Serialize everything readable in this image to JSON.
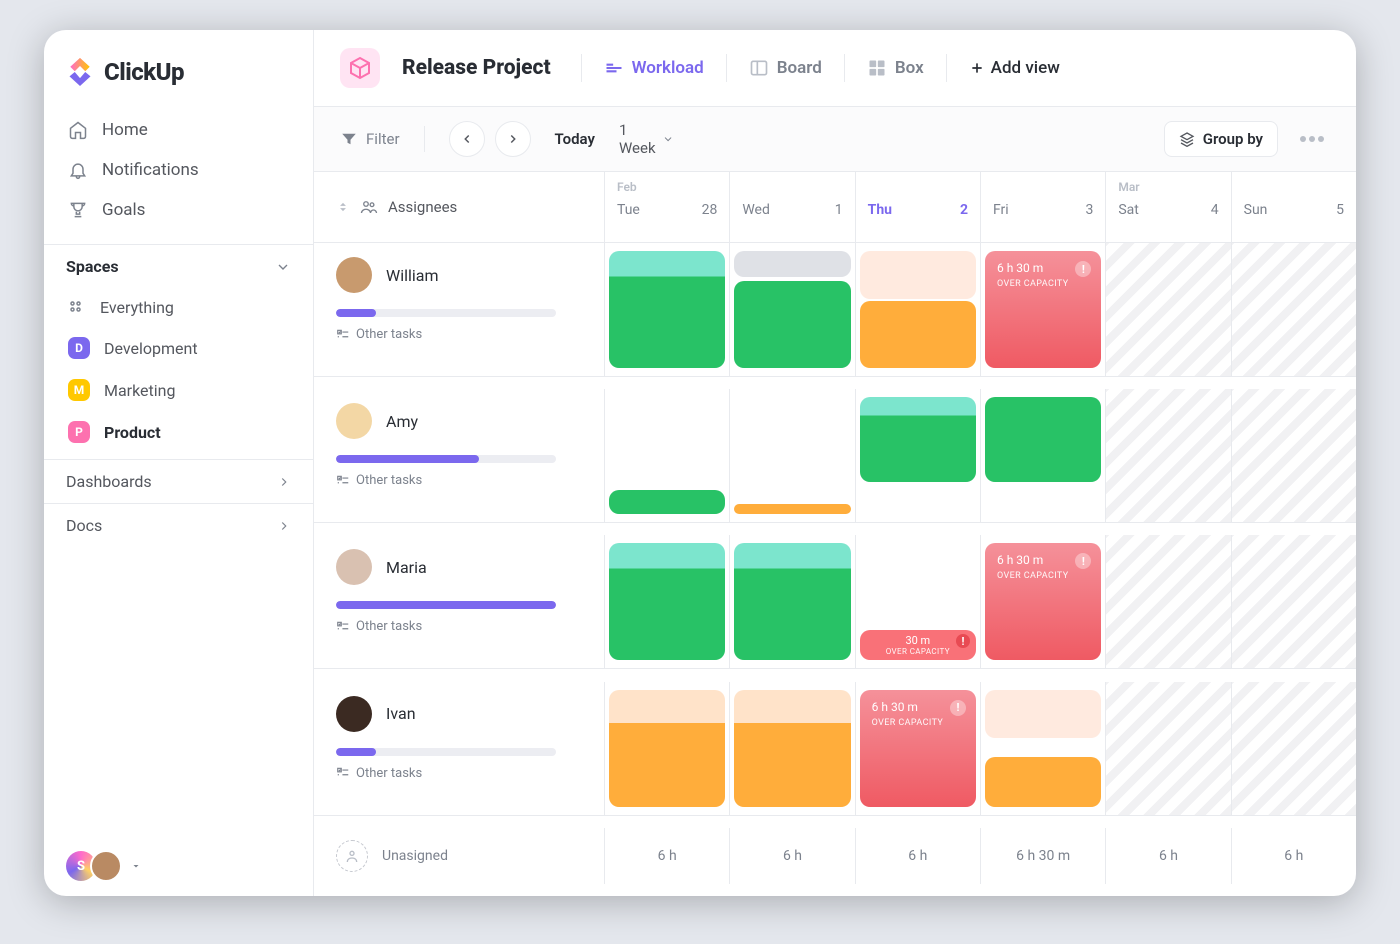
{
  "brand": {
    "name": "ClickUp"
  },
  "nav": {
    "home": "Home",
    "notifications": "Notifications",
    "goals": "Goals"
  },
  "spaces": {
    "header": "Spaces",
    "everything": "Everything",
    "items": [
      {
        "letter": "D",
        "label": "Development",
        "color": "#7b68ee"
      },
      {
        "letter": "M",
        "label": "Marketing",
        "color": "#ffc800"
      },
      {
        "letter": "P",
        "label": "Product",
        "color": "#fd71af",
        "active": true
      }
    ]
  },
  "collapse": {
    "dashboards": "Dashboards",
    "docs": "Docs"
  },
  "userFoot": {
    "initial": "S"
  },
  "project": {
    "title": "Release Project"
  },
  "views": {
    "workload": "Workload",
    "board": "Board",
    "box": "Box",
    "add": "Add view"
  },
  "toolbar": {
    "filter": "Filter",
    "today": "Today",
    "range": "1 Week",
    "group": "Group by"
  },
  "header": {
    "assignees": "Assignees",
    "months": {
      "feb": "Feb",
      "mar": "Mar"
    },
    "days": [
      {
        "dow": "Tue",
        "num": "28"
      },
      {
        "dow": "Wed",
        "num": "1"
      },
      {
        "dow": "Thu",
        "num": "2",
        "today": true
      },
      {
        "dow": "Fri",
        "num": "3"
      },
      {
        "dow": "Sat",
        "num": "4"
      },
      {
        "dow": "Sun",
        "num": "5"
      }
    ]
  },
  "otherTasks": "Other tasks",
  "overCapacity": {
    "time": "6 h 30 m",
    "timeShort": "30 m",
    "label": "OVER CAPACITY"
  },
  "assignees": [
    {
      "name": "William",
      "progress": 18,
      "avatar": "#c89a6e"
    },
    {
      "name": "Amy",
      "progress": 65,
      "avatar": "#f3d7a5"
    },
    {
      "name": "Maria",
      "progress": 100,
      "avatar": "#d9c1b1"
    },
    {
      "name": "Ivan",
      "progress": 18,
      "avatar": "#3b2a22"
    }
  ],
  "unassigned": {
    "label": "Unasigned"
  },
  "footerTotals": [
    "6 h",
    "6 h",
    "6 h",
    "6 h 30 m",
    "6 h",
    "6 h"
  ]
}
